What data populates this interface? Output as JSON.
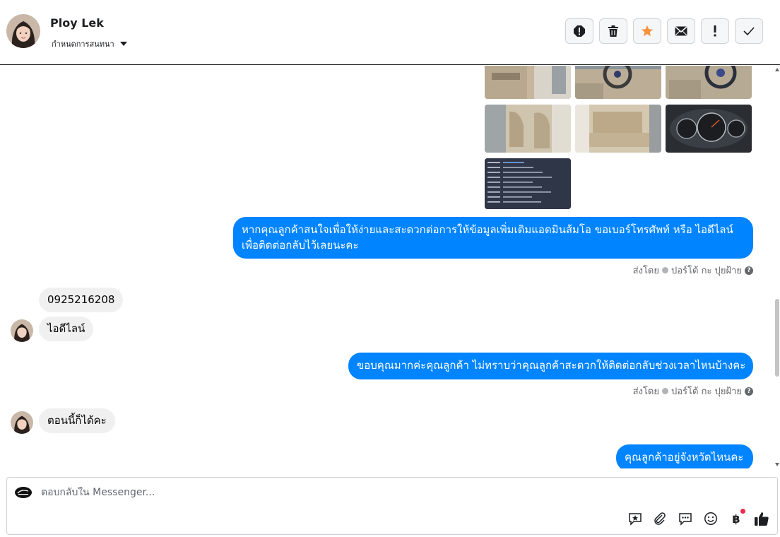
{
  "header": {
    "contact_name": "Ploy Lek",
    "subtitle": "กำหนดการสนทนา",
    "actions": [
      "report-icon",
      "trash-icon",
      "star-icon",
      "mail-icon",
      "exclamation-icon",
      "check-icon"
    ]
  },
  "messages": {
    "doc_lines": [
      "",
      "",
      "",
      "",
      "",
      "",
      "",
      "",
      ""
    ],
    "out1_line1": "หากคุณลูกค้าสนใจเพื่อให้ง่ายและสะดวกต่อการให้ข้อมูลเพิ่มเติมแอดมินส้มโอ ขอเบอร์โทรศัพท์ หรือ ไอดีไลน์",
    "out1_line2": "เพื่อติดต่อกลับไว้เลยนะคะ",
    "sent_by_label": "ส่งโดย",
    "sender_name": "ปอร์โต้ กะ ปุยฝ้าย",
    "in1": "0925216208",
    "in2": "ไอดีไลน์",
    "out2": "ขอบคุณมากค่ะคุณลูกค้า ไม่ทราบว่าคุณลูกค้าสะดวกให้ติดต่อกลับช่วงเวลาไหนบ้างคะ",
    "in3": "ตอนนี้ก็ได้คะ",
    "out3": "คุณลูกค้าอยู่จังหวัดไหนคะ"
  },
  "composer": {
    "placeholder": "ตอบกลับใน Messenger...",
    "currency_glyph": "฿"
  },
  "colors": {
    "accent_blue": "#0084ff",
    "incoming_bg": "#f0f0f0",
    "star_orange": "#f7923b",
    "notif_red": "#f02849"
  }
}
